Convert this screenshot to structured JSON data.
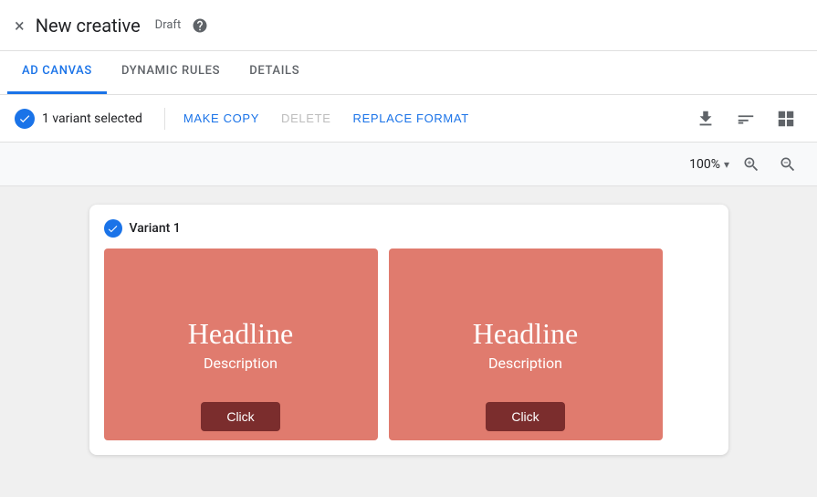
{
  "topbar": {
    "title": "New creative",
    "draft_label": "Draft",
    "close_icon": "×",
    "help_icon": "?"
  },
  "tabs": [
    {
      "id": "ad-canvas",
      "label": "AD CANVAS",
      "active": true
    },
    {
      "id": "dynamic-rules",
      "label": "DYNAMIC RULES",
      "active": false
    },
    {
      "id": "details",
      "label": "DETAILS",
      "active": false
    }
  ],
  "actionbar": {
    "selected_text": "1 variant selected",
    "make_copy_label": "MAKE COPY",
    "delete_label": "DELETE",
    "replace_format_label": "REPLACE FORMAT"
  },
  "zoom": {
    "level": "100%",
    "arrow": "▾"
  },
  "canvas": {
    "variant_label": "Variant 1",
    "ad1": {
      "headline": "Headline",
      "description": "Description",
      "button_label": "Click"
    },
    "ad2": {
      "headline": "Headline",
      "description": "Description",
      "button_label": "Click"
    }
  },
  "colors": {
    "accent": "#1a73e8",
    "ad_bg": "#e07b6e",
    "ad_btn": "#7b2d2d"
  }
}
